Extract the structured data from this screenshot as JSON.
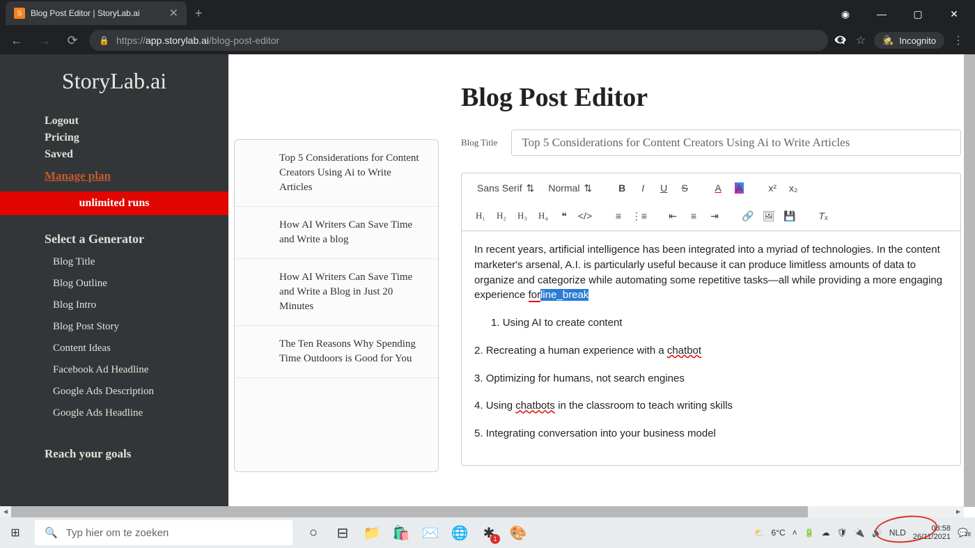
{
  "browser": {
    "tab_title": "Blog Post Editor | StoryLab.ai",
    "url_prefix": "https://",
    "url_domain": "app.storylab.ai",
    "url_path": "/blog-post-editor",
    "incognito_label": "Incognito"
  },
  "sidebar": {
    "brand": "StoryLab.ai",
    "links": [
      "Logout",
      "Pricing",
      "Saved"
    ],
    "manage_plan": "Manage plan",
    "banner": "unlimited runs",
    "generator_header": "Select a Generator",
    "generators": [
      "Blog Title",
      "Blog Outline",
      "Blog Intro",
      "Blog Post Story",
      "Content Ideas",
      "Facebook Ad Headline",
      "Google Ads Description",
      "Google Ads Headline"
    ],
    "goals_header": "Reach your goals"
  },
  "posts": [
    "Top 5 Considerations for Content Creators Using Ai to Write Articles",
    "How AI Writers Can Save Time and Write a blog",
    "How AI Writers Can Save Time and Write a Blog in Just 20 Minutes",
    "The Ten Reasons Why Spending Time Outdoors is Good for You"
  ],
  "editor": {
    "heading": "Blog Post Editor",
    "title_label": "Blog Title",
    "title_value": "Top 5 Considerations for Content Creators Using Ai to Write Articles",
    "font_select": "Sans Serif",
    "size_select": "Normal",
    "body_intro_a": "In recent years, artificial intelligence has been integrated into a myriad of technologies. In the content marketer's arsenal, A.I. is particularly useful because it can produce limitless amounts of data to organize and categorize while automating some repetitive tasks—all while providing a more engaging experience ",
    "body_intro_b": "for",
    "body_intro_sel": "line_break",
    "items": [
      {
        "n": "1.",
        "text": "Using AI to create content",
        "indent": true
      },
      {
        "n": "2.",
        "text_a": "Recreating a human experience with a ",
        "link": "chatbot"
      },
      {
        "n": "3.",
        "text": "Optimizing for humans, not search engines"
      },
      {
        "n": "4.",
        "text_a": "Using ",
        "link": "chatbots",
        "text_b": " in the classroom to teach writing skills"
      },
      {
        "n": "5.",
        "text": "Integrating conversation into your business model"
      }
    ]
  },
  "taskbar": {
    "search_placeholder": "Typ hier om te zoeken",
    "weather": "6°C",
    "lang": "NLD",
    "time": "08:58",
    "date": "26/11/2021",
    "notif_count": "18"
  }
}
